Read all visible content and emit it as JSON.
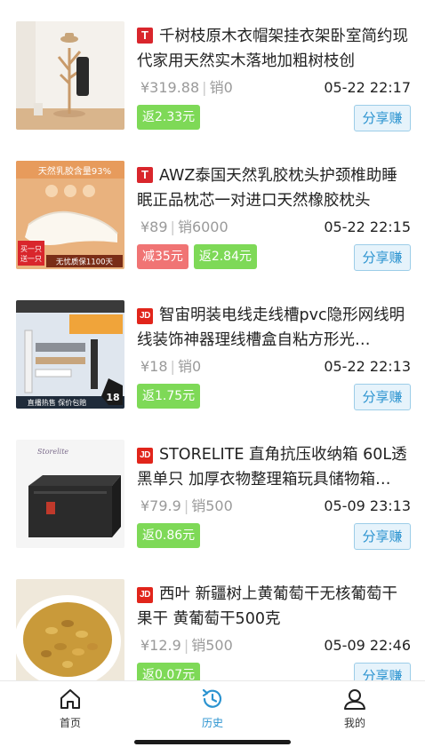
{
  "items": [
    {
      "platform": "T",
      "title": "千树枝原木衣帽架挂衣架卧室简约现代家用天然实木落地加粗树枝创",
      "price": "¥319.88",
      "sales": "销0",
      "time": "05-22 22:17",
      "tags": [
        {
          "text": "返2.33元",
          "color": "green"
        }
      ],
      "share_label": "分享赚"
    },
    {
      "platform": "T",
      "title": "AWZ泰国天然乳胶枕头护颈椎助睡眠正品枕芯一对进口天然橡胶枕头",
      "price": "¥89",
      "sales": "销6000",
      "time": "05-22 22:15",
      "tags": [
        {
          "text": "减35元",
          "color": "red"
        },
        {
          "text": "返2.84元",
          "color": "green"
        }
      ],
      "share_label": "分享赚",
      "image_text": {
        "top": "天然乳胶含量93%",
        "badge1": "买一只",
        "badge2": "送一只",
        "bottom": "无忧质保1100天"
      }
    },
    {
      "platform": "JD",
      "title": "智宙明装电线走线槽pvc隐形网线明线装饰神器理线槽盒自粘方形光…",
      "price": "¥18",
      "sales": "销0",
      "time": "05-22 22:13",
      "tags": [
        {
          "text": "返1.75元",
          "color": "green"
        }
      ],
      "share_label": "分享赚",
      "image_text": {
        "bottom": "直播热售 保价包赔",
        "num": "18"
      }
    },
    {
      "platform": "JD",
      "title": "STORELITE 直角抗压收纳箱 60L透黑单只 加厚衣物整理箱玩具储物箱…",
      "price": "¥79.9",
      "sales": "销500",
      "time": "05-09 23:13",
      "tags": [
        {
          "text": "返0.86元",
          "color": "green"
        }
      ],
      "share_label": "分享赚",
      "image_text": {
        "brand": "Storelite"
      }
    },
    {
      "platform": "JD",
      "title": "西叶 新疆树上黄葡萄干无核葡萄干果干 黄葡萄干500克",
      "price": "¥12.9",
      "sales": "销500",
      "time": "05-09 22:46",
      "tags": [
        {
          "text": "返0.07元",
          "color": "green"
        }
      ],
      "share_label": "分享赚"
    }
  ],
  "tabbar": {
    "home": "首页",
    "history": "历史",
    "mine": "我的",
    "active": "history",
    "active_color": "#2b93d0"
  },
  "colors": {
    "tmall": "#d9262c",
    "jd": "#e1251b",
    "rebate_tag": "#7ed957",
    "discount_tag": "#f07474",
    "share_button": "#2b93d0"
  },
  "icons": [
    "tmall-icon",
    "jd-icon",
    "home-icon",
    "history-icon",
    "user-icon"
  ]
}
